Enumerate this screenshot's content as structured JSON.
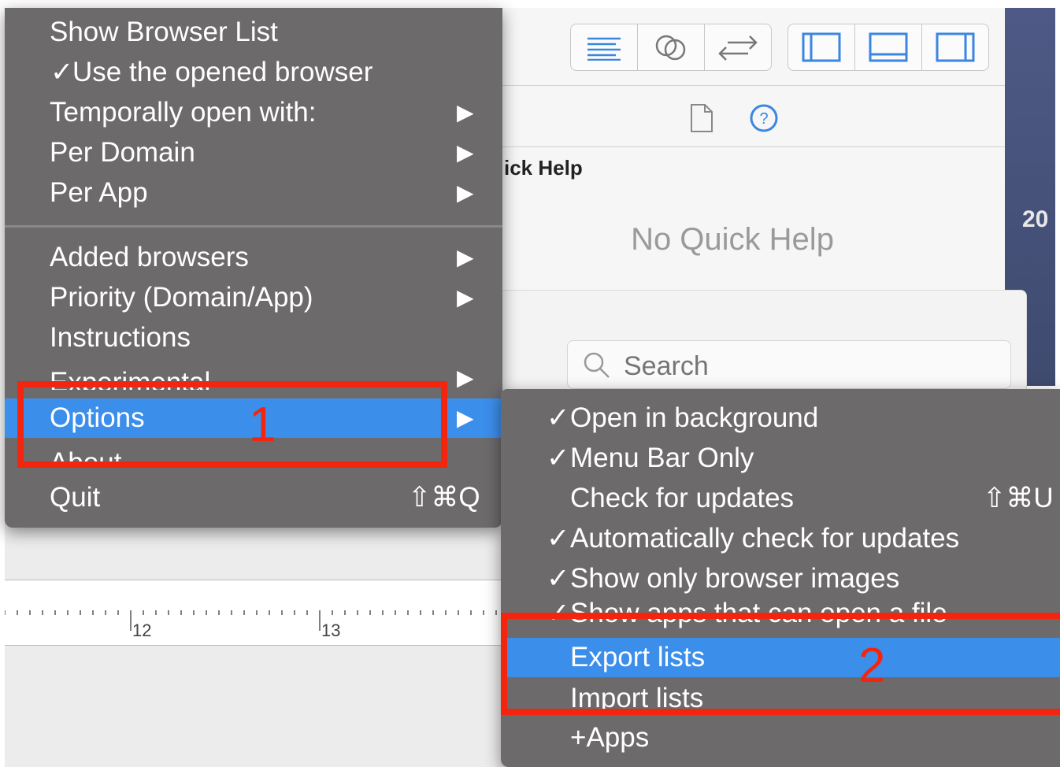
{
  "inspector": {
    "section_title": "ick Help",
    "empty_message": "No Quick Help"
  },
  "right_strip_text": "20",
  "library": {
    "search_placeholder": "Search"
  },
  "ruler": {
    "labels": [
      "12",
      "13"
    ]
  },
  "main_menu": {
    "items": [
      {
        "label": "Show Browser List"
      },
      {
        "label": "Use the opened browser",
        "checked": true
      },
      {
        "label": "Temporally open with:",
        "submenu": true
      },
      {
        "label": "Per Domain",
        "submenu": true
      },
      {
        "label": "Per App",
        "submenu": true
      },
      {
        "label": "Added browsers",
        "submenu": true
      },
      {
        "label": "Priority (Domain/App)",
        "submenu": true
      },
      {
        "label": "Instructions"
      },
      {
        "label": "Experimental",
        "submenu": true
      },
      {
        "label": "Options",
        "submenu": true,
        "highlighted": true
      },
      {
        "label": "About"
      },
      {
        "label": "Quit",
        "shortcut": "⇧⌘Q"
      }
    ],
    "check_mark": "✓",
    "arrow_glyph": "▶"
  },
  "options_menu": {
    "items": [
      {
        "label": "Open in background",
        "checked": true
      },
      {
        "label": "Menu Bar Only",
        "checked": true
      },
      {
        "label": "Check for updates",
        "shortcut": "⇧⌘U"
      },
      {
        "label": "Automatically check for updates",
        "checked": true
      },
      {
        "label": "Show only browser images",
        "checked": true
      },
      {
        "label": "Show apps that can open a file",
        "checked": true
      },
      {
        "label": "Export lists",
        "highlighted": true
      },
      {
        "label": "Import lists"
      },
      {
        "label": "+Apps"
      }
    ]
  },
  "annotations": {
    "box1_number": "1",
    "box2_number": "2"
  },
  "colors": {
    "menu_background": "#6c6a6b",
    "highlight": "#3c8eeb",
    "annotation_red": "#f4250e"
  }
}
